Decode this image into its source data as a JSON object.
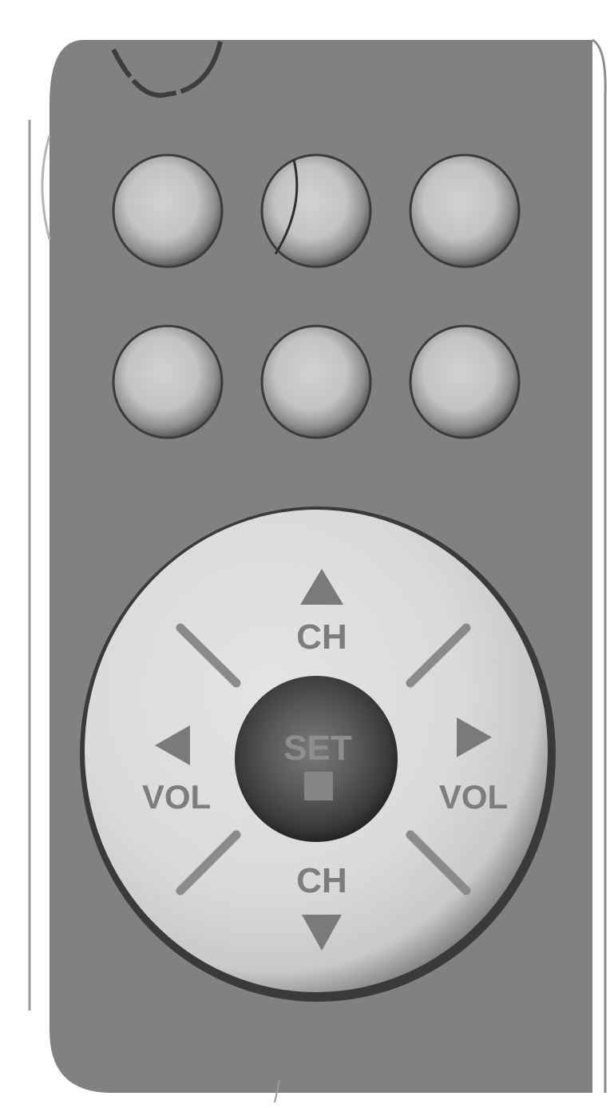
{
  "remote": {
    "body_color": "#818181",
    "button_count": 6,
    "buttons": [
      {
        "name": "grey-button-1"
      },
      {
        "name": "grey-button-2"
      },
      {
        "name": "grey-button-3"
      },
      {
        "name": "grey-button-4"
      },
      {
        "name": "grey-button-5"
      },
      {
        "name": "grey-button-6"
      }
    ],
    "nav_pad": {
      "up_label": "CH",
      "down_label": "CH",
      "left_label": "VOL",
      "right_label": "VOL",
      "center_label": "SET",
      "up_icon": "triangle-up-icon",
      "down_icon": "triangle-down-icon",
      "left_icon": "triangle-left-icon",
      "right_icon": "triangle-right-icon",
      "center_icon": "square-stop-icon"
    }
  }
}
